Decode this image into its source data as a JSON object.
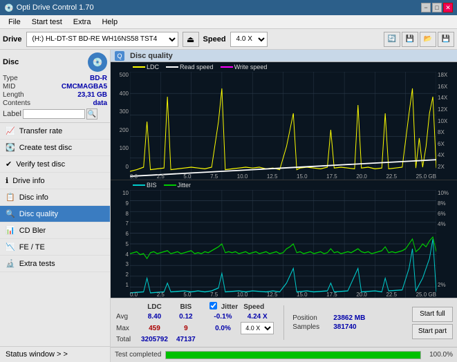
{
  "app": {
    "title": "Opti Drive Control 1.70",
    "title_icon": "💿"
  },
  "title_controls": {
    "minimize": "−",
    "maximize": "□",
    "close": "✕"
  },
  "menu": {
    "items": [
      "File",
      "Start test",
      "Extra",
      "Help"
    ]
  },
  "drive_bar": {
    "label": "Drive",
    "drive_value": "(H:)  HL-DT-ST BD-RE  WH16NS58 TST4",
    "speed_label": "Speed",
    "speed_value": "4.0 X",
    "eject_icon": "⏏"
  },
  "disc": {
    "title": "Disc",
    "type_label": "Type",
    "type_value": "BD-R",
    "mid_label": "MID",
    "mid_value": "CMCMAGBA5",
    "length_label": "Length",
    "length_value": "23,31 GB",
    "contents_label": "Contents",
    "contents_value": "data",
    "label_label": "Label",
    "label_value": ""
  },
  "nav": {
    "items": [
      {
        "id": "transfer-rate",
        "label": "Transfer rate",
        "icon": "📈"
      },
      {
        "id": "create-test-disc",
        "label": "Create test disc",
        "icon": "💽"
      },
      {
        "id": "verify-test-disc",
        "label": "Verify test disc",
        "icon": "✔"
      },
      {
        "id": "drive-info",
        "label": "Drive info",
        "icon": "ℹ"
      },
      {
        "id": "disc-info",
        "label": "Disc info",
        "icon": "📋"
      },
      {
        "id": "disc-quality",
        "label": "Disc quality",
        "icon": "🔍",
        "active": true
      },
      {
        "id": "cd-bler",
        "label": "CD Bler",
        "icon": "📊"
      },
      {
        "id": "fe-te",
        "label": "FE / TE",
        "icon": "📉"
      },
      {
        "id": "extra-tests",
        "label": "Extra tests",
        "icon": "🔬"
      }
    ],
    "status_window": "Status window > >"
  },
  "quality": {
    "title": "Disc quality",
    "chart1": {
      "legend": [
        {
          "label": "LDC",
          "color": "#ffff00"
        },
        {
          "label": "Read speed",
          "color": "#ffffff"
        },
        {
          "label": "Write speed",
          "color": "#ff00ff"
        }
      ],
      "y_labels_left": [
        "500",
        "400",
        "300",
        "200",
        "100",
        "0"
      ],
      "y_labels_right": [
        "18X",
        "16X",
        "14X",
        "12X",
        "10X",
        "8X",
        "6X",
        "4X",
        "2X"
      ],
      "x_labels": [
        "0.0",
        "2.5",
        "5.0",
        "7.5",
        "10.0",
        "12.5",
        "15.0",
        "17.5",
        "20.0",
        "22.5",
        "25.0 GB"
      ]
    },
    "chart2": {
      "legend": [
        {
          "label": "BIS",
          "color": "#00ffff"
        },
        {
          "label": "Jitter",
          "color": "#00ff00"
        }
      ],
      "y_labels_left": [
        "10",
        "9",
        "8",
        "7",
        "6",
        "5",
        "4",
        "3",
        "2",
        "1"
      ],
      "y_labels_right": [
        "10%",
        "8%",
        "6%",
        "4%",
        "2%"
      ],
      "x_labels": [
        "0.0",
        "2.5",
        "5.0",
        "7.5",
        "10.0",
        "12.5",
        "15.0",
        "17.5",
        "20.0",
        "22.5",
        "25.0 GB"
      ]
    }
  },
  "stats": {
    "headers": [
      "",
      "LDC",
      "BIS",
      "",
      "Jitter",
      "Speed"
    ],
    "avg_label": "Avg",
    "avg_ldc": "8.40",
    "avg_bis": "0.12",
    "avg_jitter": "-0.1%",
    "max_label": "Max",
    "max_ldc": "459",
    "max_bis": "9",
    "max_jitter": "0.0%",
    "total_label": "Total",
    "total_ldc": "3205792",
    "total_bis": "47137",
    "speed_avg": "4.24 X",
    "speed_select": "4.0 X",
    "jitter_checked": true,
    "jitter_label": "Jitter",
    "position_label": "Position",
    "position_value": "23862 MB",
    "samples_label": "Samples",
    "samples_value": "381740",
    "btn_start_full": "Start full",
    "btn_start_part": "Start part"
  },
  "progress": {
    "text": "Test completed",
    "percent": 100.0,
    "percent_label": "100.0%"
  },
  "colors": {
    "accent_blue": "#3a7cc1",
    "active_nav": "#3a7cc1",
    "chart_bg": "#0a1520",
    "ldc_color": "#ffff00",
    "bis_color": "#00ffff",
    "jitter_color": "#00cc00",
    "speed_color": "#ffffff",
    "progress_green": "#00c000"
  }
}
